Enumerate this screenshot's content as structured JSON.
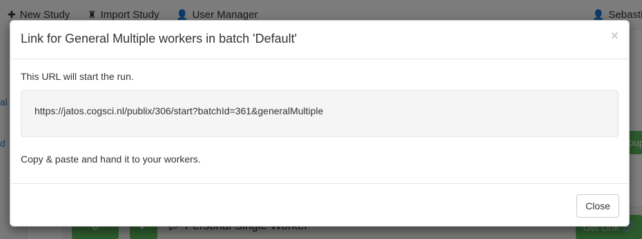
{
  "navbar": {
    "items": [
      {
        "label": "New Study",
        "icon": "plus-icon"
      },
      {
        "label": "Import Study",
        "icon": "import-icon"
      },
      {
        "label": "User Manager",
        "icon": "user-icon"
      }
    ],
    "user_label": "Sebastia"
  },
  "background": {
    "sidebar_fragments": [
      "al",
      "d"
    ],
    "row_label": "Personal Single Worker",
    "get_link_label": "Get Link",
    "group_button_fragment": "oup"
  },
  "modal": {
    "title": "Link for General Multiple workers in batch 'Default'",
    "close_symbol": "×",
    "intro": "This URL will start the run.",
    "url": "https://jatos.cogsci.nl/publix/306/start?batchId=361&generalMultiple",
    "instructions": "Copy & paste and hand it to your workers.",
    "close_button_label": "Close"
  },
  "colors": {
    "overlay": "rgba(0,0,0,0.5)",
    "success_green": "#5cb85c",
    "link_blue": "#337ab7"
  }
}
